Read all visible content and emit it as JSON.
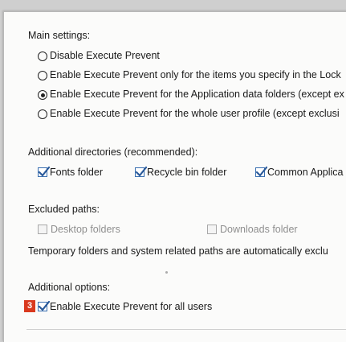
{
  "main_settings": {
    "heading": "Main settings:",
    "options": [
      {
        "label": "Disable Execute Prevent",
        "selected": false
      },
      {
        "label": "Enable Execute Prevent only for the items you specify in the Lock",
        "selected": false
      },
      {
        "label": "Enable Execute Prevent for the Application data folders (except ex",
        "selected": true
      },
      {
        "label": "Enable Execute Prevent for the whole user profile (except exclusi",
        "selected": false
      }
    ]
  },
  "additional_directories": {
    "heading": "Additional directories (recommended):",
    "items": [
      {
        "label": "Fonts folder",
        "checked": true
      },
      {
        "label": "Recycle bin folder",
        "checked": true
      },
      {
        "label": "Common Applica",
        "checked": true
      }
    ]
  },
  "excluded_paths": {
    "heading": "Excluded paths:",
    "items": [
      {
        "label": "Desktop folders",
        "checked": false,
        "enabled": false
      },
      {
        "label": "Downloads folder",
        "checked": false,
        "enabled": false
      }
    ],
    "note": "Temporary folders and system related paths are automatically exclu"
  },
  "additional_options": {
    "heading": "Additional options:",
    "badge": "3",
    "items": [
      {
        "label": "Enable Execute Prevent for all users",
        "checked": true
      }
    ]
  },
  "colors": {
    "checkbox_border": "#3a6fb0",
    "checkmark": "#2a5a9a",
    "badge": "#d9391e",
    "disabled_text": "#8f8f8f"
  }
}
